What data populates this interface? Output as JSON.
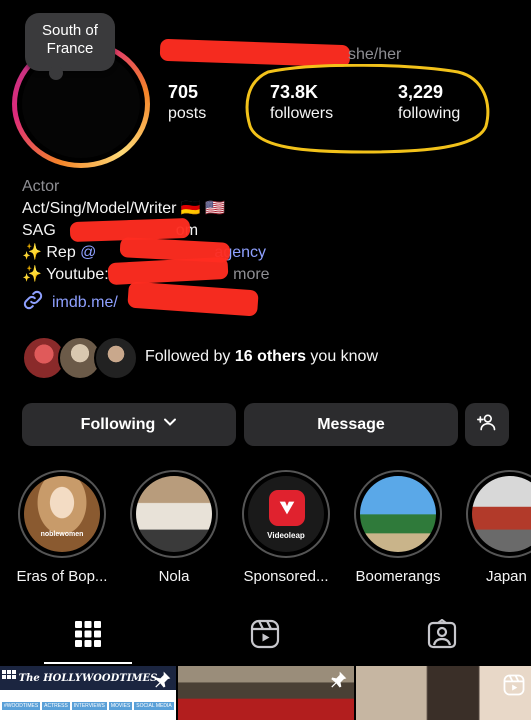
{
  "profile": {
    "note": "South of France",
    "pronouns": "she/her",
    "category": "Actor",
    "bio_lines": {
      "line1": "Act/Sing/Model/Writer 🇩🇪 🇺🇸",
      "line2_prefix": "SAG",
      "line2_suffix": "om",
      "line3_prefix": "✨ Rep ",
      "line3_at": "@",
      "line3_tail": "agency",
      "line4_prefix": "✨ Youtube: ",
      "line4_more": "more"
    },
    "link": "imdb.me/"
  },
  "stats": {
    "posts": {
      "value": "705",
      "label": "posts"
    },
    "followers": {
      "value": "73.8K",
      "label": "followers"
    },
    "following": {
      "value": "3,229",
      "label": "following"
    }
  },
  "mutuals": {
    "prefix": "Followed by ",
    "count": "16 others",
    "suffix": " you know"
  },
  "actions": {
    "following_label": "Following",
    "message_label": "Message"
  },
  "highlights": [
    {
      "label": "Eras of Bop...",
      "caption": "noblewomen"
    },
    {
      "label": "Nola"
    },
    {
      "label": "Sponsored...",
      "caption": "Videoleap"
    },
    {
      "label": "Boomerangs"
    },
    {
      "label": "Japan"
    }
  ],
  "grid": {
    "post1_title": "The HOLLYWOODTIMES",
    "post1_tags": [
      "#WOODTIMES",
      "ACTRESS",
      "INTERVIEWS",
      "MOVIES",
      "SOCIAL MEDIA"
    ]
  },
  "colors": {
    "accent_link": "#8ea0ff",
    "highlight_circle": "#f2c21a",
    "redaction": "#ff2d20",
    "button_bg": "#2c2c2e"
  }
}
